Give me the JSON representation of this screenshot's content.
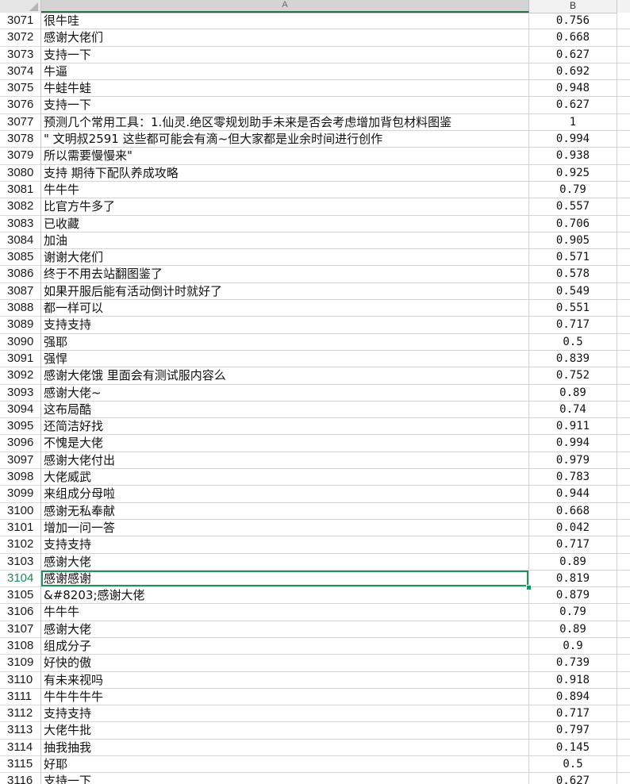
{
  "columns": {
    "a": "A",
    "b": "B"
  },
  "active_row_index": 33,
  "rows": [
    {
      "num": "3071",
      "a": "很牛哇",
      "b": "0.756"
    },
    {
      "num": "3072",
      "a": "感谢大佬们",
      "b": "0.668"
    },
    {
      "num": "3073",
      "a": "支持一下",
      "b": "0.627"
    },
    {
      "num": "3074",
      "a": "牛逼",
      "b": "0.692"
    },
    {
      "num": "3075",
      "a": "牛蛙牛蛙",
      "b": "0.948"
    },
    {
      "num": "3076",
      "a": "支持一下",
      "b": "0.627"
    },
    {
      "num": "3077",
      "a": "预测几个常用工具：1.仙灵.绝区零规划助手未来是否会考虑增加背包材料图鉴",
      "b": "1"
    },
    {
      "num": "3078",
      "a": "\"      文明叔2591 这些都可能会有滴~但大家都是业余时间进行创作",
      "b": "0.994"
    },
    {
      "num": "3079",
      "a": "所以需要慢慢来\"",
      "b": "0.938"
    },
    {
      "num": "3080",
      "a": "支持 期待下配队养成攻略",
      "b": "0.925"
    },
    {
      "num": "3081",
      "a": "牛牛牛",
      "b": "0.79"
    },
    {
      "num": "3082",
      "a": "比官方牛多了",
      "b": "0.557"
    },
    {
      "num": "3083",
      "a": "已收藏",
      "b": "0.706"
    },
    {
      "num": "3084",
      "a": "加油",
      "b": "0.905"
    },
    {
      "num": "3085",
      "a": "谢谢大佬们",
      "b": "0.571"
    },
    {
      "num": "3086",
      "a": "终于不用去站翻图鉴了",
      "b": "0.578"
    },
    {
      "num": "3087",
      "a": "如果开服后能有活动倒计时就好了",
      "b": "0.549"
    },
    {
      "num": "3088",
      "a": "都一样可以",
      "b": "0.551"
    },
    {
      "num": "3089",
      "a": "支持支持",
      "b": "0.717"
    },
    {
      "num": "3090",
      "a": "强耶",
      "b": "0.5"
    },
    {
      "num": "3091",
      "a": "强悍",
      "b": "0.839"
    },
    {
      "num": "3092",
      "a": "感谢大佬饿  里面会有测试服内容么",
      "b": "0.752"
    },
    {
      "num": "3093",
      "a": "感谢大佬~",
      "b": "0.89"
    },
    {
      "num": "3094",
      "a": "这布局酷",
      "b": "0.74"
    },
    {
      "num": "3095",
      "a": "还简洁好找",
      "b": "0.911"
    },
    {
      "num": "3096",
      "a": "不愧是大佬",
      "b": "0.994"
    },
    {
      "num": "3097",
      "a": "感谢大佬付出",
      "b": "0.979"
    },
    {
      "num": "3098",
      "a": "大佬威武",
      "b": "0.783"
    },
    {
      "num": "3099",
      "a": "来组成分母啦",
      "b": "0.944"
    },
    {
      "num": "3100",
      "a": "感谢无私奉献",
      "b": "0.668"
    },
    {
      "num": "3101",
      "a": "增加一问一答",
      "b": "0.042"
    },
    {
      "num": "3102",
      "a": "支持支持",
      "b": "0.717"
    },
    {
      "num": "3103",
      "a": "感谢大佬",
      "b": "0.89"
    },
    {
      "num": "3104",
      "a": "感谢感谢",
      "b": "0.819"
    },
    {
      "num": "3105",
      "a": "&#8203;感谢大佬",
      "b": "0.879"
    },
    {
      "num": "3106",
      "a": "牛牛牛",
      "b": "0.79"
    },
    {
      "num": "3107",
      "a": "感谢大佬",
      "b": "0.89"
    },
    {
      "num": "3108",
      "a": "组成分子",
      "b": "0.9"
    },
    {
      "num": "3109",
      "a": "好快的傲",
      "b": "0.739"
    },
    {
      "num": "3110",
      "a": "有未来视吗",
      "b": "0.918"
    },
    {
      "num": "3111",
      "a": "牛牛牛牛牛",
      "b": "0.894"
    },
    {
      "num": "3112",
      "a": "支持支持",
      "b": "0.717"
    },
    {
      "num": "3113",
      "a": "大佬牛批",
      "b": "0.797"
    },
    {
      "num": "3114",
      "a": "抽我抽我",
      "b": "0.145"
    },
    {
      "num": "3115",
      "a": "好耶",
      "b": "0.5"
    },
    {
      "num": "3116",
      "a": "支持一下",
      "b": "0.627"
    }
  ]
}
